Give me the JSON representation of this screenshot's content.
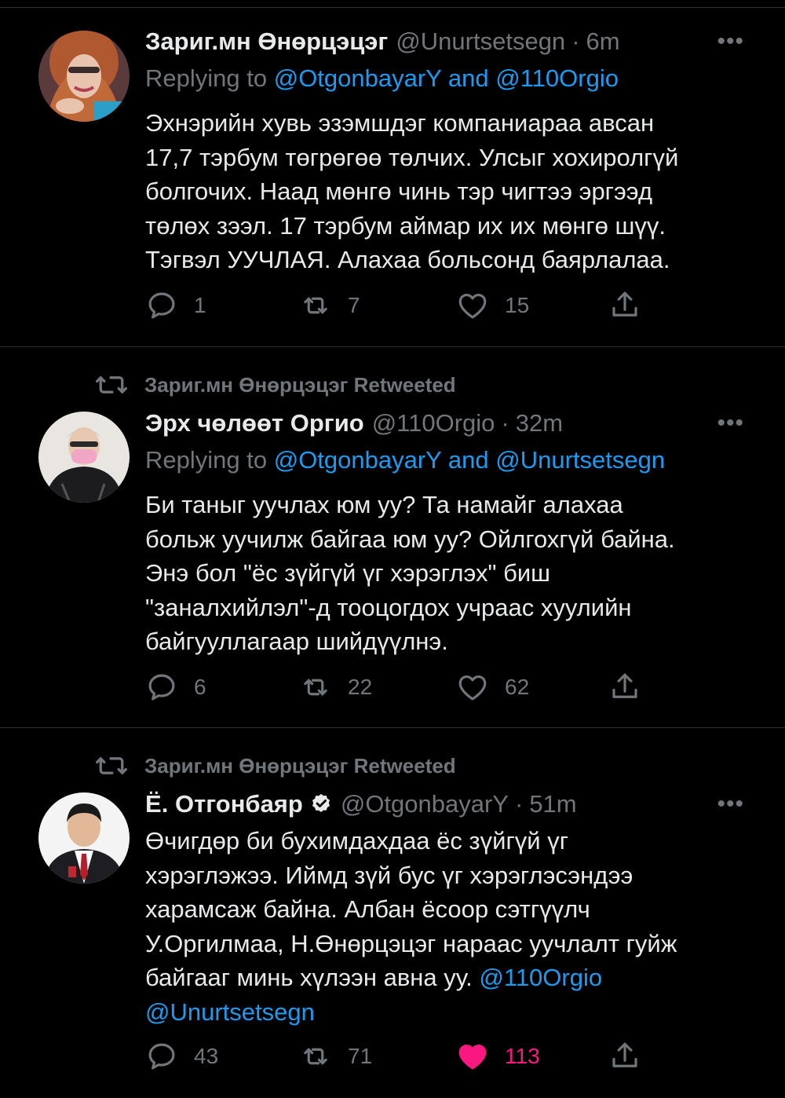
{
  "tweets": [
    {
      "retweet_banner": "",
      "name": "Зариг.мн Өнөрцэцэг",
      "handle": "@Unurtsetsegn",
      "time": "6m",
      "verified": false,
      "replying_prefix": "Replying to ",
      "replying_user1": "@OtgonbayarY",
      "replying_and": " and ",
      "replying_user2": "@110Orgio",
      "text": "Эхнэрийн хувь эзэмшдэг компаниараа  авсан\n17,7 тэрбум төгрөгөө төлчих. Улсыг хохиролгүй\nболгочих. Наад мөнгө чинь тэр чигтээ эргээд\nтөлөх зээл. 17 тэрбум аймар их их мөнгө шүү.\nТэгвэл УУЧЛАЯ. Алахаа больсонд баярлалаа.",
      "replies": "1",
      "retweets": "7",
      "likes": "15",
      "liked": false
    },
    {
      "retweet_banner": "Зариг.мн Өнөрцэцэг Retweeted",
      "name": "Эрх чөлөөт Оргио",
      "handle": "@110Orgio",
      "time": "32m",
      "verified": false,
      "replying_prefix": "Replying to ",
      "replying_user1": "@OtgonbayarY",
      "replying_and": " and ",
      "replying_user2": "@Unurtsetsegn",
      "text": "Би таныг уучлах юм уу? Та намайг алахаа\nбольж уучилж байгаа юм уу? Ойлгохгүй байна.\nЭнэ бол \"ёс зүйгүй үг хэрэглэх\" биш\n\"заналхийлэл\"-д тооцогдох учраас хуулийн\nбайгууллагаар шийдүүлнэ.",
      "replies": "6",
      "retweets": "22",
      "likes": "62",
      "liked": false
    },
    {
      "retweet_banner": "Зариг.мн Өнөрцэцэг Retweeted",
      "name": "Ё. Отгонбаяр",
      "handle": "@OtgonbayarY",
      "time": "51m",
      "verified": true,
      "text_main": "Өчигдөр би бухимдахдаа ёс зүйгүй үг\nхэрэглэжээ. Иймд зүй бус үг хэрэглэсэндээ\nхарамсаж байна. Албан ёсоор сэтгүүлч\nУ.Оргилмаа, Н.Өнөрцэцэг нараас уучлалт гуйж\nбайгааг минь хүлээн авна уу. ",
      "text_mention1": "@110Orgio",
      "text_mention2": "@Unurtsetsegn",
      "replies": "43",
      "retweets": "71",
      "likes": "113",
      "liked": true
    }
  ],
  "separator_dot": "·",
  "more_icon_text": "•••",
  "icons": {
    "reply": "speech-bubble-icon",
    "retweet": "retweet-arrows-icon",
    "like": "heart-icon",
    "share": "share-upload-icon",
    "verified": "verified-badge-icon"
  },
  "colors": {
    "background": "#000000",
    "text": "#e7e9ea",
    "secondary": "#71767b",
    "link": "#1d9bf0",
    "like": "#f91880"
  }
}
